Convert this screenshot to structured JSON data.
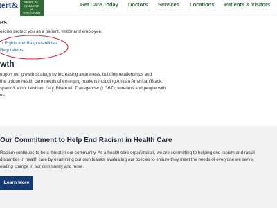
{
  "header": {
    "logo": {
      "word_fragment": "tert",
      "amp": "&",
      "badge_lines": [
        "MEDICAL",
        "COLLEGE",
        "of WISCONSIN"
      ]
    },
    "nav": [
      {
        "label": "Get Care Today"
      },
      {
        "label": "Doctors"
      },
      {
        "label": "Services"
      },
      {
        "label": "Locations"
      },
      {
        "label": "Patients & Visitors"
      }
    ]
  },
  "policies": {
    "heading_fragment": "es",
    "text": "olicies protect you as a patient, visitor and employee.",
    "link1": "t Rights and Responsibilities",
    "link2": " Regulations"
  },
  "growth": {
    "heading_fragment": "wth",
    "lines": [
      "upport our growth strategy by increasing awareness, building relationships and",
      " the unique health care needs of emerging markets including African American/Black;",
      "spanic/Latino; Lesbian, Gay, Bisexual, Transgender (LGBT); veterans and people with",
      "es."
    ]
  },
  "commitment": {
    "title": "Our Commitment to Help End Racism in Health Care",
    "lines": [
      "Racism continues to be a threat in our community. As a health care organization, we are committing to helping end racism and racial",
      "disparities in health care by examining our own biases, evaluating our policies to ensure they meet the needs of everyone we serve,",
      "eading change in our community and more."
    ],
    "button_label": "Learn More"
  },
  "colors": {
    "nav_green": "#2f6d35",
    "link_blue": "#2f6d9e",
    "button_navy": "#153a73",
    "annotation_red": "#d42a3a",
    "section_gray": "#f2f2f2"
  }
}
